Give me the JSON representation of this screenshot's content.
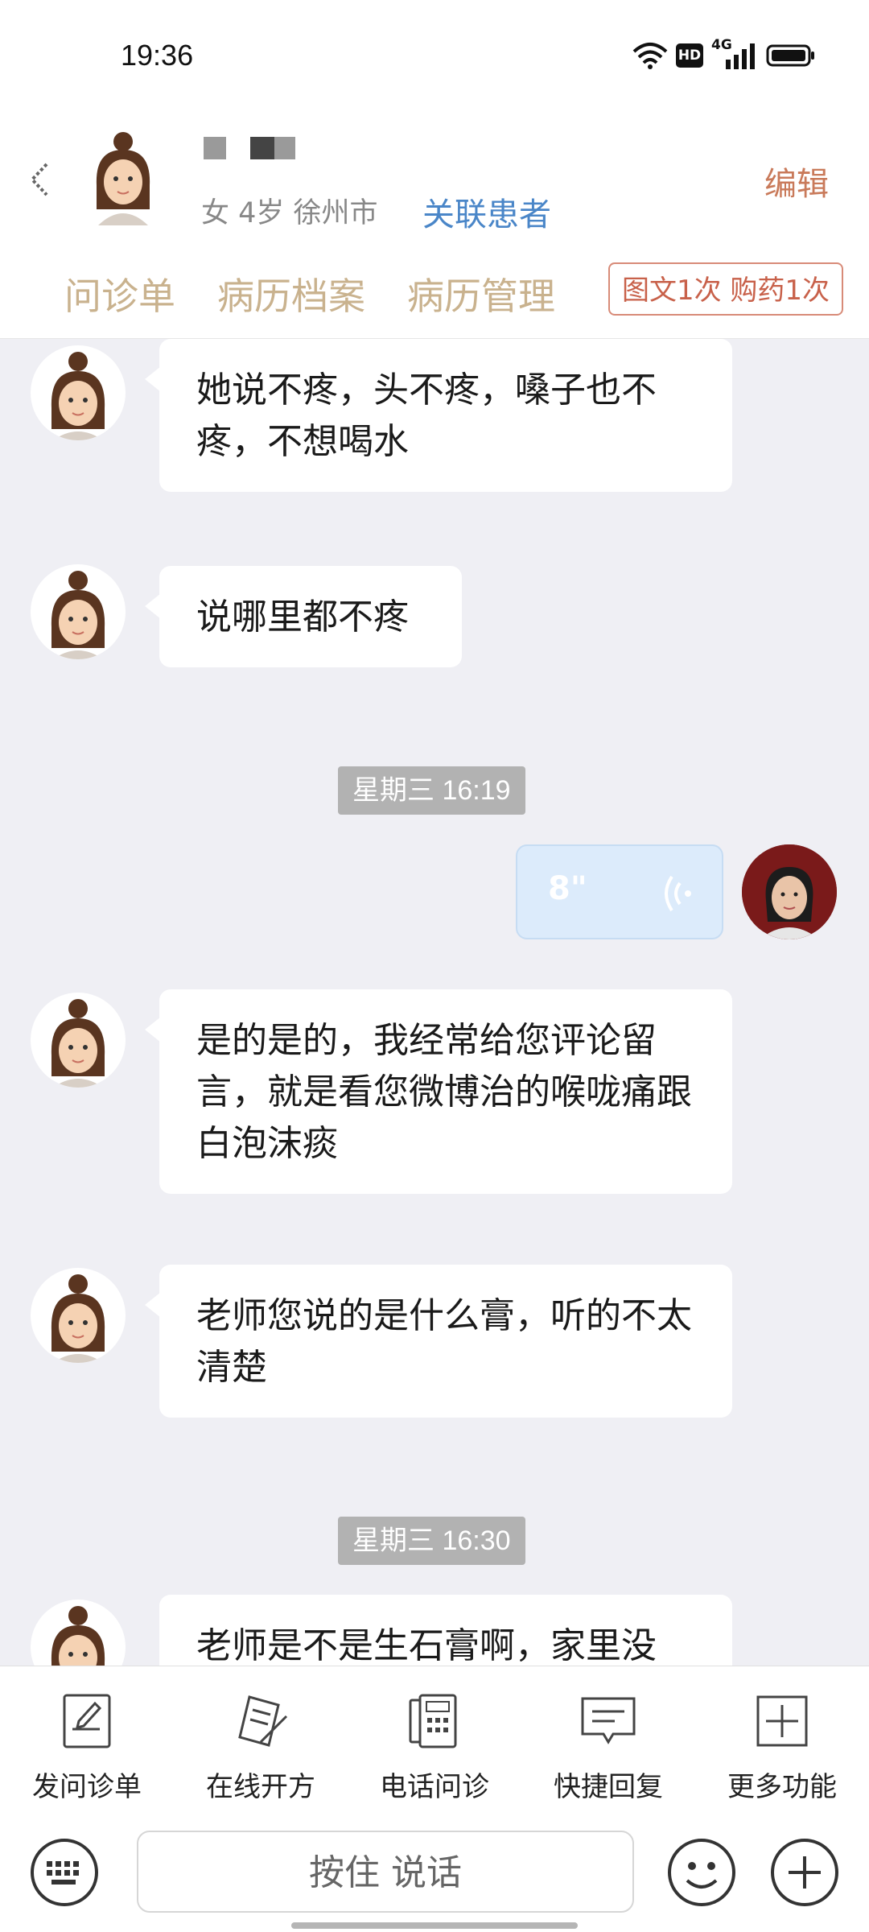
{
  "status_bar": {
    "time": "19:36",
    "hd_badge": "HD",
    "network": "4G"
  },
  "header": {
    "patient_info": "女 4岁  徐州市",
    "link_label": "关联患者",
    "edit_label": "编辑",
    "tabs": [
      {
        "label": "问诊单"
      },
      {
        "label": "病历档案"
      },
      {
        "label": "病历管理"
      }
    ],
    "tag": "图文1次 购药1次"
  },
  "messages": [
    {
      "type": "text",
      "from": "patient",
      "text": "她说不疼，头不疼，嗓子也不疼，不想喝水"
    },
    {
      "type": "text",
      "from": "patient",
      "text": "说哪里都不疼"
    },
    {
      "type": "timestamp",
      "text": "星期三 16:19"
    },
    {
      "type": "voice",
      "from": "doctor",
      "duration": "8\""
    },
    {
      "type": "text",
      "from": "patient",
      "text": "是的是的，我经常给您评论留言，就是看您微博治的喉咙痛跟白泡沫痰"
    },
    {
      "type": "text",
      "from": "patient",
      "text": "老师您说的是什么膏，听的不太清楚"
    },
    {
      "type": "timestamp",
      "text": "星期三 16:30"
    },
    {
      "type": "text",
      "from": "patient",
      "text": "老师是不是生石膏啊，家里没"
    }
  ],
  "toolbar": {
    "items": [
      {
        "label": "发问诊单",
        "icon": "form-icon"
      },
      {
        "label": "在线开方",
        "icon": "prescription-icon"
      },
      {
        "label": "电话问诊",
        "icon": "phone-icon"
      },
      {
        "label": "快捷回复",
        "icon": "quick-reply-icon"
      },
      {
        "label": "更多功能",
        "icon": "more-icon"
      }
    ]
  },
  "input": {
    "hold_to_talk": "按住 说话"
  },
  "colors": {
    "accent_tab": "#c9b28e",
    "link": "#4a86c8",
    "edit": "#c97a5a",
    "tag": "#c8614a",
    "voice_bubble": "#dcebfb"
  }
}
